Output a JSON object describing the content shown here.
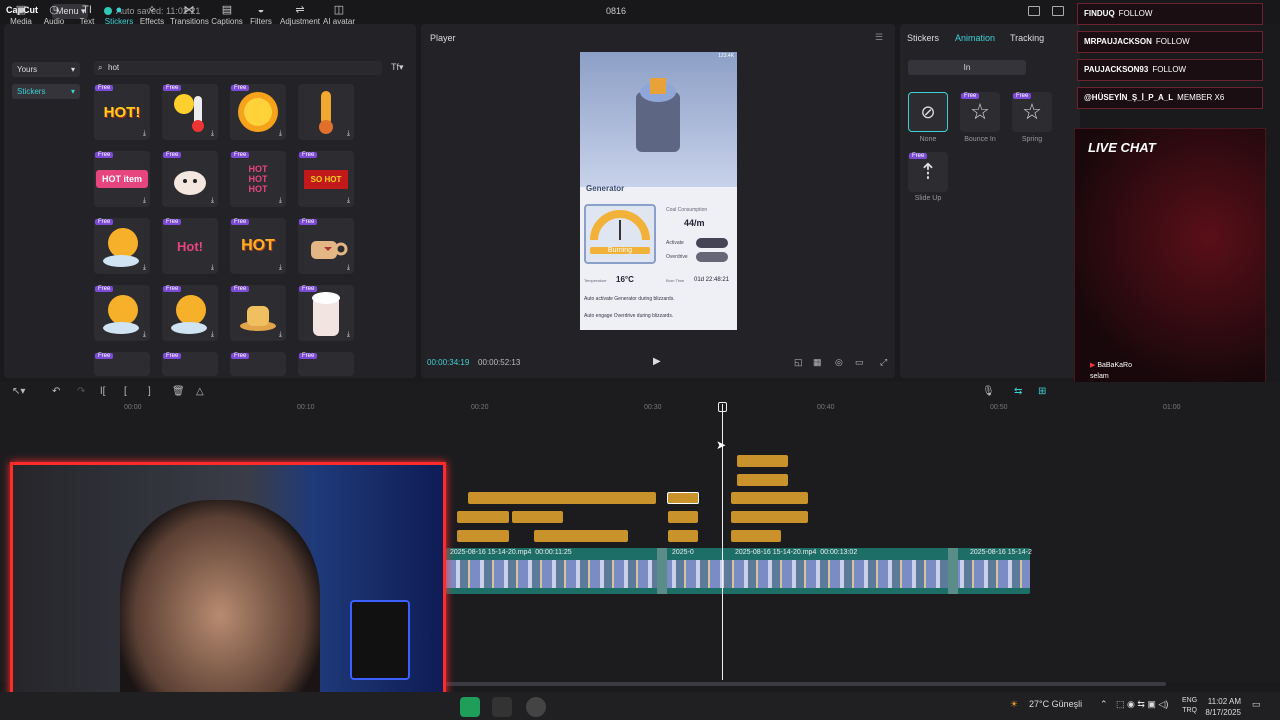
{
  "app": {
    "logo": "CapCut",
    "menu_label": "Menu",
    "autosave": "Auto saved: 11:02:21",
    "project_title": "0816"
  },
  "toolbar": {
    "tools": [
      "Media",
      "Audio",
      "Text",
      "Stickers",
      "Effects",
      "Transitions",
      "Captions",
      "Filters",
      "Adjustment",
      "AI avatar"
    ],
    "active": "Stickers"
  },
  "library": {
    "source_select": "Yours",
    "category": "Stickers",
    "search_value": "hot",
    "free_label": "Free",
    "stickers": [
      "HOT!",
      "",
      "",
      "",
      "HOT item",
      "",
      "HOT HOT HOT",
      "SO HOT",
      "",
      "Hot!",
      "HOT",
      "",
      "",
      "",
      "",
      ""
    ]
  },
  "player": {
    "title": "Player",
    "time_current": "00:00:34:19",
    "time_total": "00:00:52:13",
    "video": {
      "banner": "Generator",
      "gauge_label": "Burning",
      "coal": "Coal Consumption",
      "rate": "44/m",
      "activate": "Activate",
      "overdrive": "Overdrive",
      "temp_label": "Temperature",
      "temp": "16°C",
      "burn_time_label": "Burn Time",
      "burn_time": "01d 22:48:21",
      "auto1": "Auto activate Generator during blizzards.",
      "auto2": "Auto engage Overdrive during blizzards.",
      "counter": "123.4K"
    }
  },
  "right": {
    "tabs": [
      "Stickers",
      "Animation",
      "Tracking"
    ],
    "active_tab": "Animation",
    "sub_tab": "In",
    "animations": [
      {
        "label": "None"
      },
      {
        "label": "Bounce In"
      },
      {
        "label": "Spring"
      },
      {
        "label": "Slide Up"
      }
    ],
    "free_label": "Free"
  },
  "overlay": {
    "follows": [
      {
        "user": "FINDUQ",
        "action": "FOLLOW"
      },
      {
        "user": "MRPAUJACKSON",
        "action": "FOLLOW"
      },
      {
        "user": "PAUJACKSON93",
        "action": "FOLLOW"
      },
      {
        "user": "@HÜSEYİN_Ş_İ_P_A_L",
        "action": "MEMBER X6"
      }
    ],
    "live_chat_title": "LIVE CHAT",
    "chat_user": "BaBaKaRo",
    "chat_message": "selam"
  },
  "timeline": {
    "ticks": [
      "00:00",
      "00:10",
      "00:20",
      "00:30",
      "00:40",
      "00:50",
      "01:00"
    ],
    "clips": [
      {
        "label": "2025-08-16 15-14-20.mp4",
        "duration": "00:00:11:25"
      },
      {
        "label": "2025-08-16 15-14-20.mp4",
        "duration": "00:00:13:02"
      },
      {
        "label": "2025-08-16 15-14-2",
        "duration": ""
      },
      {
        "label": "2025-0",
        "duration": ""
      }
    ]
  },
  "taskbar": {
    "weather": "27°C Güneşli",
    "lang1": "ENG",
    "lang2": "TRQ",
    "time": "11:02 AM",
    "date": "8/17/2025"
  }
}
